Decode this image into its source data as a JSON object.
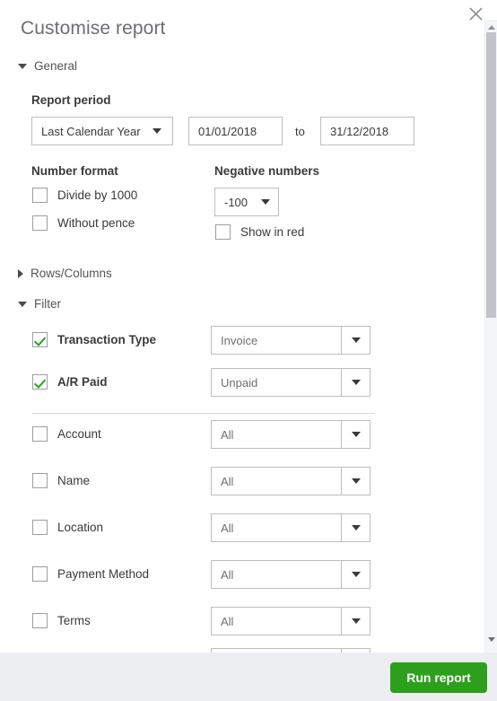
{
  "panel": {
    "title": "Customise report",
    "close_icon": "close-icon"
  },
  "sections": {
    "general": {
      "label": "General",
      "expanded": true,
      "icon": "chevron-down-icon"
    },
    "rows_columns": {
      "label": "Rows/Columns",
      "expanded": false,
      "icon": "chevron-right-icon"
    },
    "filter": {
      "label": "Filter",
      "expanded": true,
      "icon": "chevron-down-icon"
    }
  },
  "general": {
    "report_period": {
      "label": "Report period",
      "preset": "Last Calendar Year",
      "date_from": "01/01/2018",
      "date_to": "31/12/2018",
      "to_label": "to",
      "from_placeholder": "dd/mm/yyyy",
      "to_placeholder": "dd/mm/yyyy"
    },
    "number_format": {
      "label": "Number format",
      "options": [
        {
          "label": "Divide by 1000",
          "checked": false
        },
        {
          "label": "Without pence",
          "checked": false
        }
      ]
    },
    "negative_numbers": {
      "label": "Negative numbers",
      "value": "-100",
      "show_in_red": {
        "label": "Show in red",
        "checked": false
      }
    }
  },
  "filter": {
    "rows": [
      {
        "label": "Transaction Type",
        "checked": true,
        "value": "Invoice"
      },
      {
        "label": "A/R Paid",
        "checked": true,
        "value": "Unpaid"
      },
      {
        "label": "Account",
        "checked": false,
        "value": "All"
      },
      {
        "label": "Name",
        "checked": false,
        "value": "All"
      },
      {
        "label": "Location",
        "checked": false,
        "value": "All"
      },
      {
        "label": "Payment Method",
        "checked": false,
        "value": "All"
      },
      {
        "label": "Terms",
        "checked": false,
        "value": "All"
      },
      {
        "label": "",
        "checked": false,
        "value": ""
      }
    ]
  },
  "footer": {
    "run_report_label": "Run report"
  },
  "colors": {
    "accent_green": "#2ca01c",
    "footer_bg": "#eceef1",
    "text": "#393a3d",
    "muted_text": "#6b6e73",
    "border": "#babec5"
  }
}
